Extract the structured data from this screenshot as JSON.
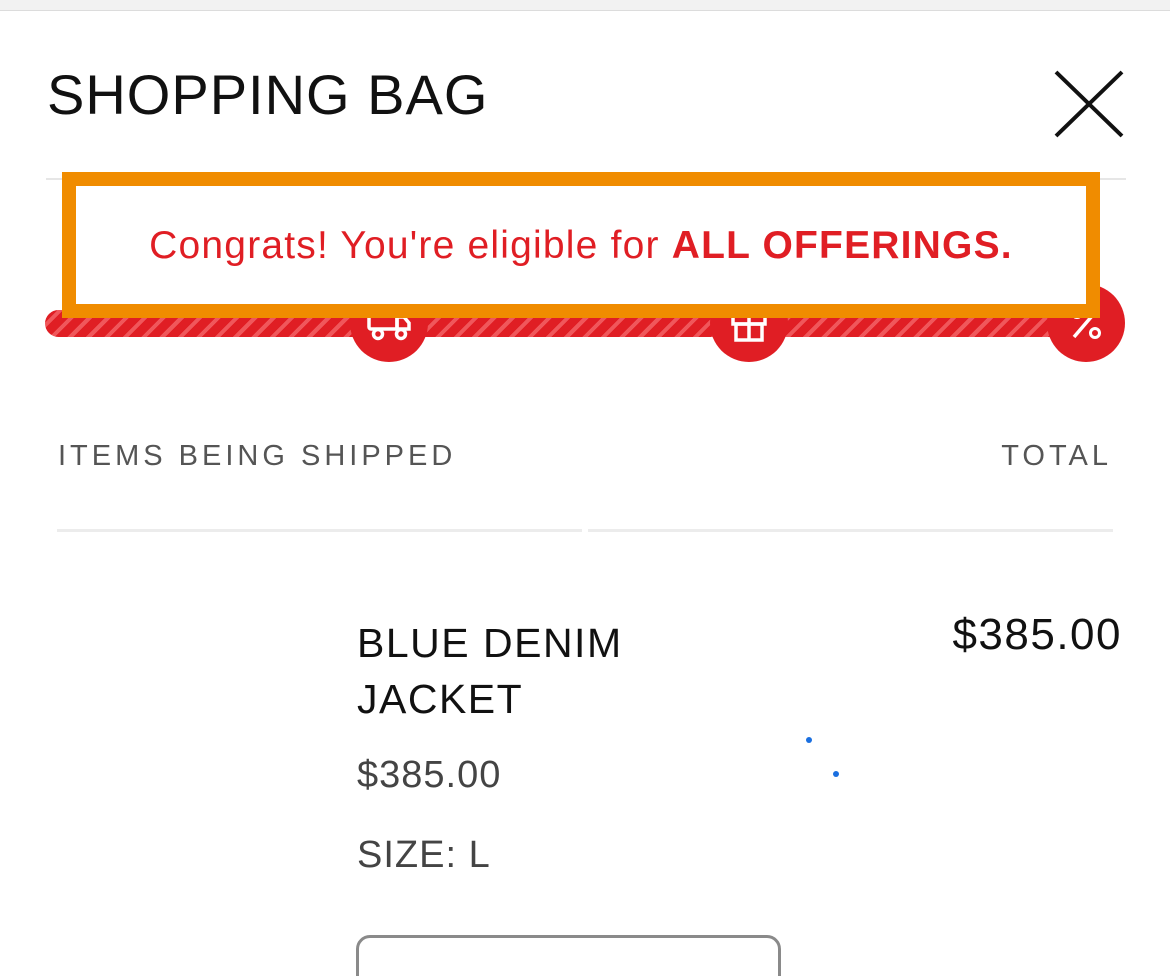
{
  "header": {
    "title": "SHOPPING BAG"
  },
  "promo": {
    "message_prefix": "Congrats! You're eligible for ",
    "message_emphasis": "ALL OFFERINGS.",
    "highlight_color": "#f08c00",
    "accent_color": "#e01e24"
  },
  "progress": {
    "fraction_complete": 1.0,
    "milestones": [
      {
        "icon": "truck-icon"
      },
      {
        "icon": "gift-icon"
      },
      {
        "icon": "percent-icon"
      }
    ]
  },
  "columns": {
    "items_label": "ITEMS BEING SHIPPED",
    "total_label": "TOTAL"
  },
  "items": [
    {
      "name": "BLUE DENIM JACKET",
      "unit_price": "$385.00",
      "size": "SIZE: L",
      "line_total": "$385.00"
    }
  ]
}
